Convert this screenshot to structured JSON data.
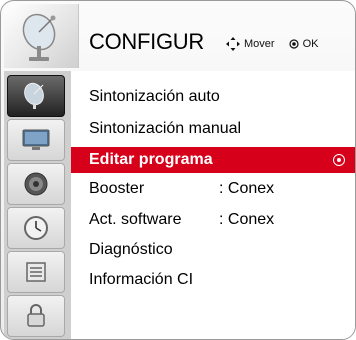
{
  "header": {
    "title": "CONFIGUR",
    "hints": [
      {
        "icon": "dpad-move-icon",
        "label": "Mover"
      },
      {
        "icon": "ok-button-icon",
        "label": "OK"
      }
    ]
  },
  "sidebar": {
    "items": [
      {
        "icon": "satellite-dish-icon",
        "active": true
      },
      {
        "icon": "tv-screen-icon",
        "active": false
      },
      {
        "icon": "speaker-audio-icon",
        "active": false
      },
      {
        "icon": "clock-time-icon",
        "active": false
      },
      {
        "icon": "settings-options-icon",
        "active": false
      },
      {
        "icon": "lock-icon",
        "active": false
      }
    ]
  },
  "menu": {
    "items": [
      {
        "label": "Sintonización auto",
        "value": ""
      },
      {
        "label": "Sintonización manual",
        "value": ""
      },
      {
        "label": "Editar programa",
        "value": "",
        "selected": true
      },
      {
        "label": "Booster",
        "value": ": Conex"
      },
      {
        "label": "Act. software",
        "value": ": Conex"
      },
      {
        "label": "Diagnóstico",
        "value": ""
      },
      {
        "label": "Información CI",
        "value": ""
      }
    ]
  },
  "colors": {
    "selection": "#d6001a",
    "rail": "#cfcfcf"
  }
}
